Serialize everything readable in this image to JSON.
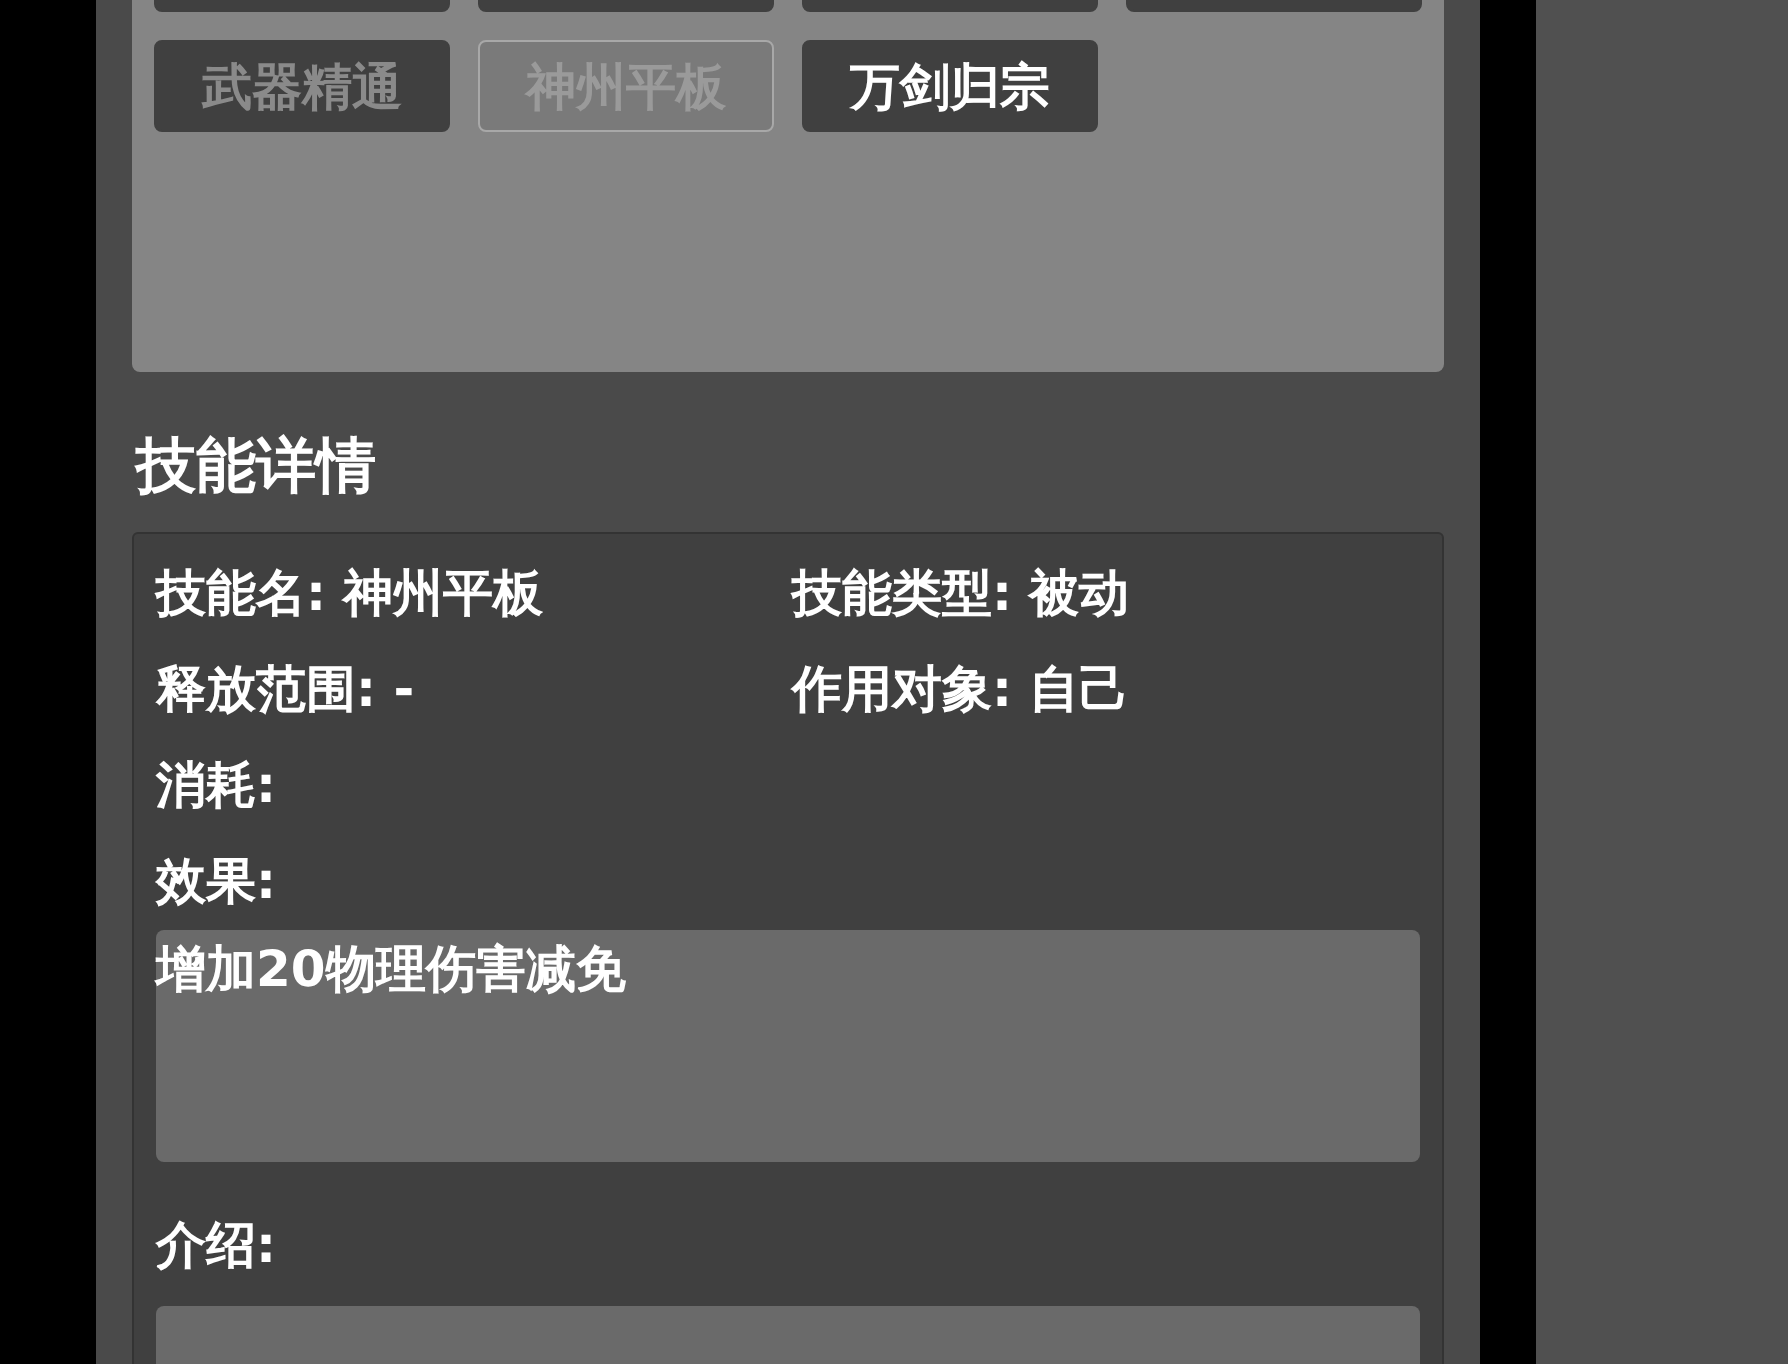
{
  "skill_buttons": [
    {
      "kind": "partial"
    },
    {
      "kind": "partial"
    },
    {
      "kind": "partial"
    },
    {
      "kind": "partial"
    },
    {
      "kind": "full",
      "label": "武器精通",
      "selected": false,
      "disabled": true
    },
    {
      "kind": "full",
      "label": "神州平板",
      "selected": true,
      "disabled": false
    },
    {
      "kind": "full",
      "label": "万剑归宗",
      "selected": false,
      "disabled": false
    }
  ],
  "details_heading": "技能详情",
  "details": {
    "fields": [
      {
        "label": "技能名:",
        "value": "神州平板"
      },
      {
        "label": "技能类型:",
        "value": "被动"
      },
      {
        "label": "释放范围:",
        "value": "-"
      },
      {
        "label": "作用对象:",
        "value": "自己"
      },
      {
        "label": "消耗:"
      },
      {
        "label": "效果:"
      }
    ],
    "effect_text": "增加20物理伤害减免",
    "intro_label": "介绍:"
  }
}
